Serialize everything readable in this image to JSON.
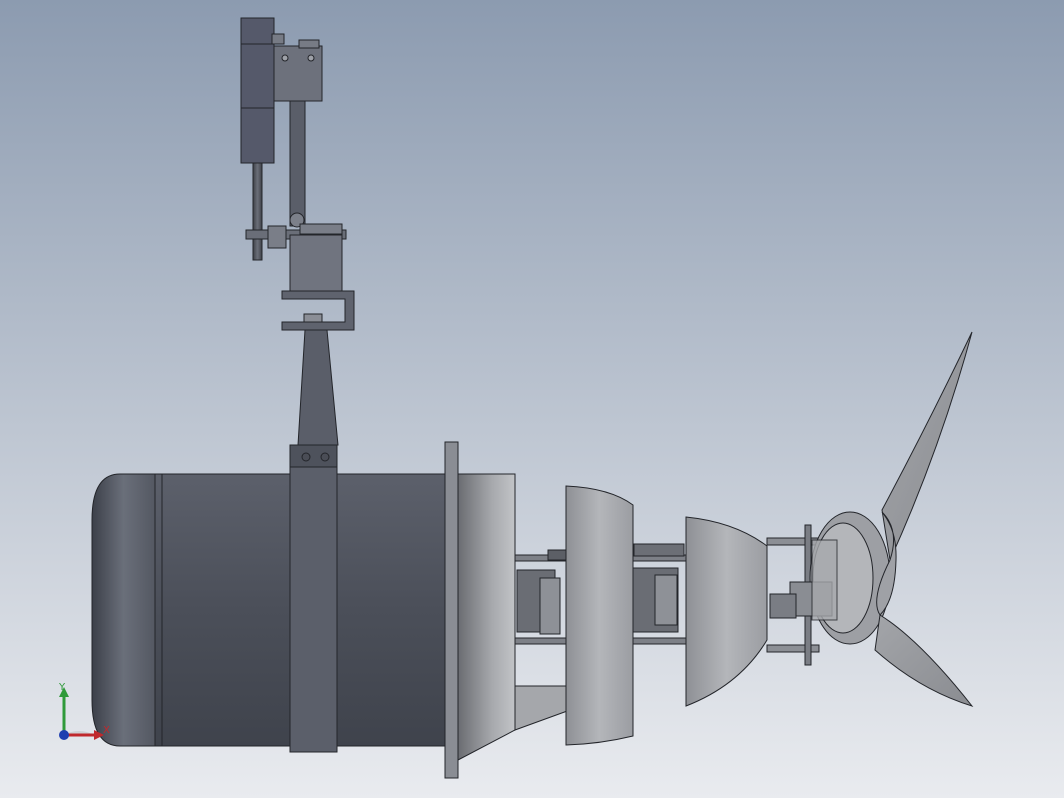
{
  "viewport": {
    "background_top": "#8c9bb0",
    "background_bottom": "#e9ebef"
  },
  "colors": {
    "motor_dark": "#50545e",
    "motor_mid": "#6f7480",
    "motor_light": "#9a9ea8",
    "metal_light": "#b9bbbf",
    "metal_mid": "#9c9ea3",
    "metal_dark": "#5e6066",
    "outline": "#23252a"
  },
  "triad": {
    "x_label": "X",
    "y_label": "Y",
    "x_color": "#c0282c",
    "y_color": "#2f9a3a",
    "z_color": "#1f3fb0"
  }
}
